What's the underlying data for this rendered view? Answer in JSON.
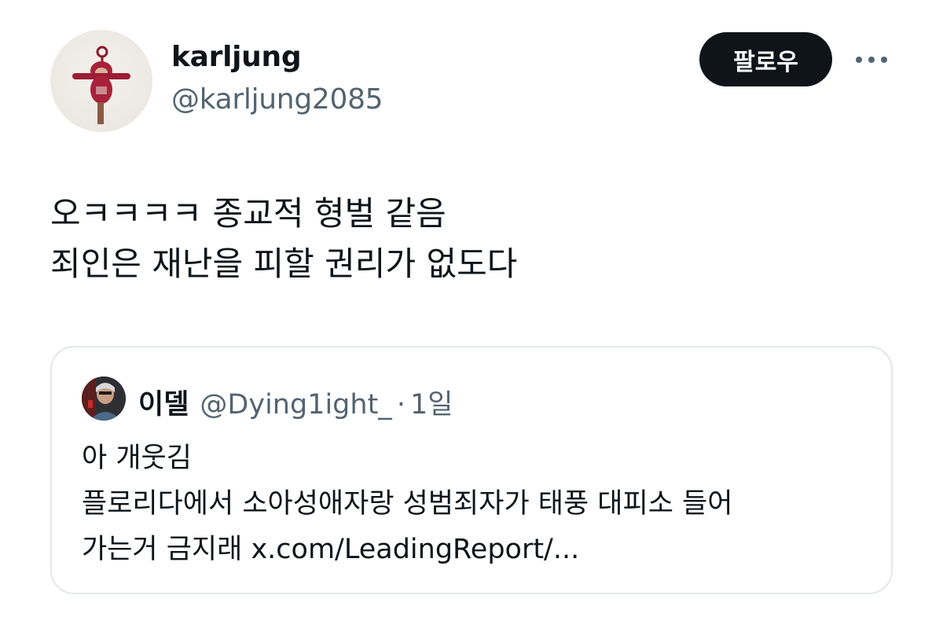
{
  "author": {
    "display_name": "karljung",
    "handle": "@karljung2085",
    "avatar_icon": "teletubby-figure-avatar"
  },
  "actions": {
    "follow_label": "팔로우",
    "more_icon": "more-horizontal-icon"
  },
  "tweet": {
    "lines": [
      "오ㅋㅋㅋㅋ 종교적 형벌 같음",
      "죄인은 재난을 피할 권리가 없도다"
    ]
  },
  "quoted_tweet": {
    "display_name": "이델",
    "handle": "@Dying1ight_",
    "separator": "·",
    "time": "1일",
    "avatar_icon": "person-photo-avatar",
    "lines": [
      "아 개웃김",
      "플로리다에서 소아성애자랑 성범죄자가 태풍 대피소 들어",
      "가는거 금지래 x.com/LeadingReport/..."
    ]
  },
  "colors": {
    "text_primary": "#0f1419",
    "text_secondary": "#536471",
    "follow_button_bg": "#0f1419",
    "card_border": "#e3e7ea"
  }
}
